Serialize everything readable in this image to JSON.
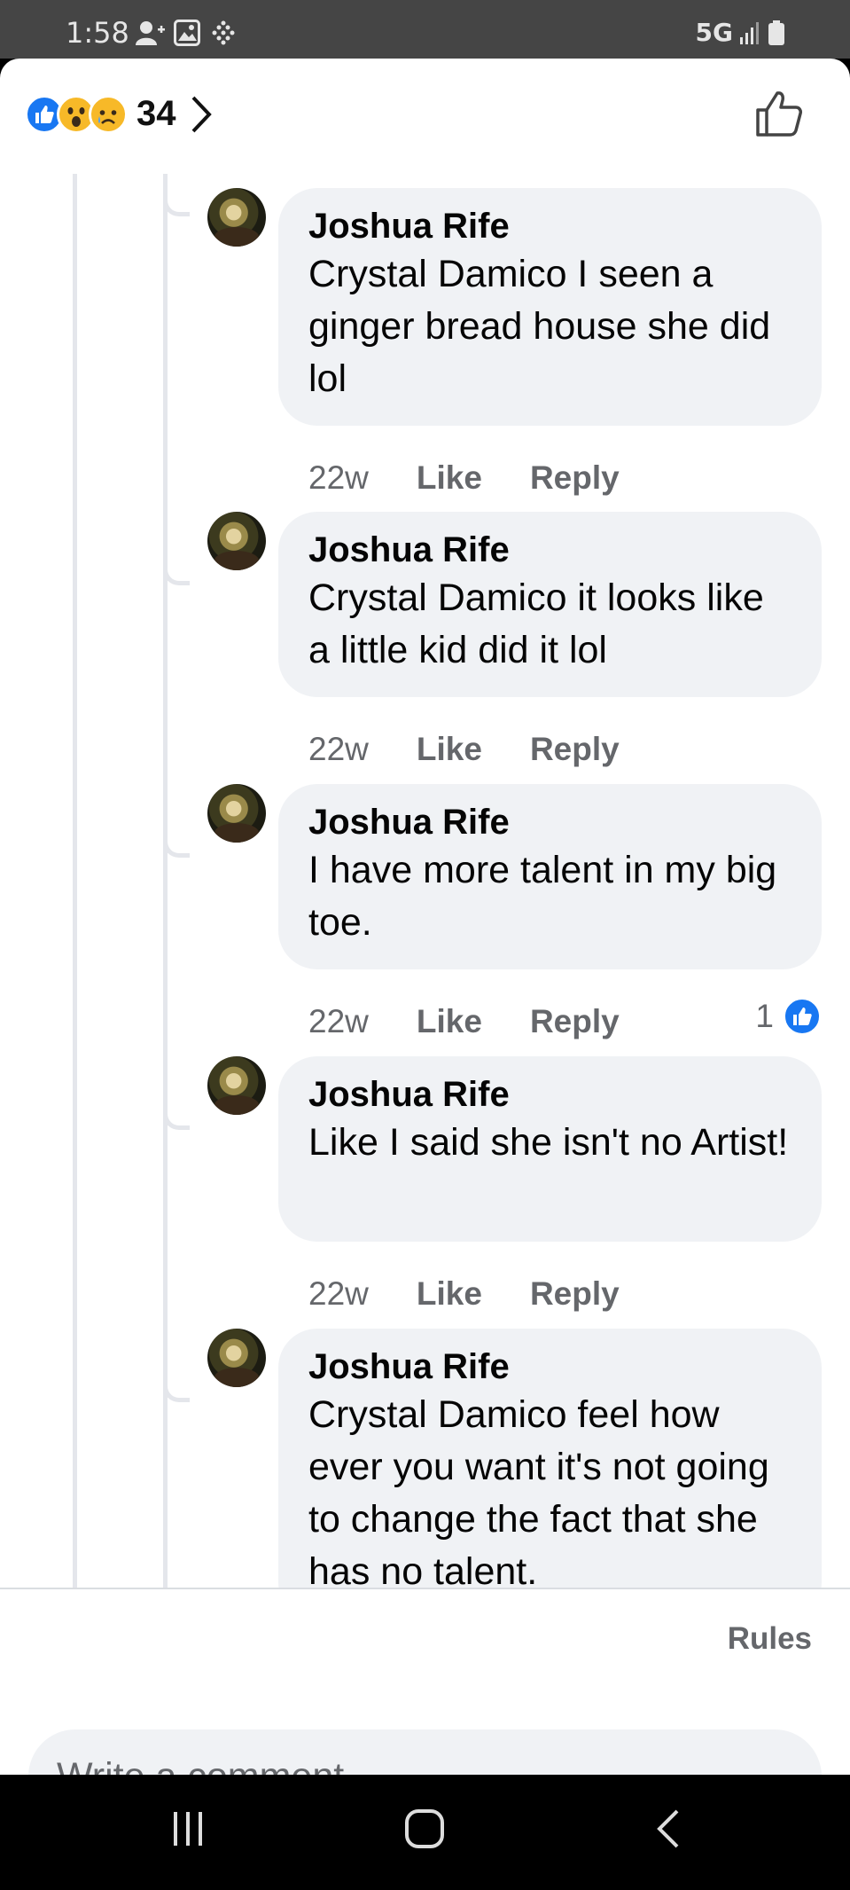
{
  "status_bar": {
    "time": "1:58",
    "network": "5G",
    "icons_left": [
      "add-person-icon",
      "image-icon",
      "dots-grid-icon"
    ],
    "icons_right": [
      "signal-icon",
      "battery-icon"
    ]
  },
  "header": {
    "reactions": [
      "like",
      "wow",
      "sad"
    ],
    "reaction_count": "34",
    "like_button_icon": "thumbs-up-outline-icon"
  },
  "comments": [
    {
      "author": "Joshua Rife",
      "text": "Crystal Damico I seen a ginger bread house she did lol",
      "time": "22w",
      "like_label": "Like",
      "reply_label": "Reply",
      "reactions": null
    },
    {
      "author": "Joshua Rife",
      "text": "Crystal Damico it looks like a little kid did it lol",
      "time": "22w",
      "like_label": "Like",
      "reply_label": "Reply",
      "reactions": null
    },
    {
      "author": "Joshua Rife",
      "text": "I have more talent in my big toe.",
      "time": "22w",
      "like_label": "Like",
      "reply_label": "Reply",
      "reactions": "1"
    },
    {
      "author": "Joshua Rife",
      "text": "Like I said she isn't no Artist!",
      "time": "22w",
      "like_label": "Like",
      "reply_label": "Reply",
      "reactions": null
    },
    {
      "author": "Joshua Rife",
      "text": "Crystal Damico feel how ever you want it's not going to change the fact that she has no talent.",
      "time": "",
      "like_label": "",
      "reply_label": "",
      "reactions": null
    }
  ],
  "composer": {
    "rules_label": "Rules",
    "placeholder": "Write a comment…"
  },
  "nav": {
    "recents_icon": "recents-icon",
    "home_icon": "home-icon",
    "back_icon": "back-icon"
  },
  "colors": {
    "accent": "#1877f2",
    "bubble": "#f0f2f5",
    "muted_text": "#65676b",
    "status_bar": "#454545"
  }
}
